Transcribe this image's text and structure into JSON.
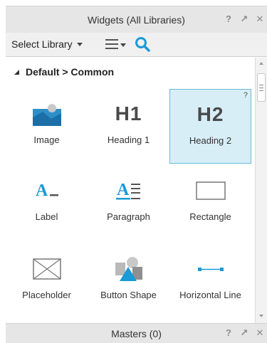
{
  "panel": {
    "title": "Widgets (All Libraries)",
    "help": "?",
    "popout": "↗",
    "close": "✕"
  },
  "toolbar": {
    "select_library": "Select Library"
  },
  "section": {
    "title": "Default > Common"
  },
  "widgets": [
    {
      "label": "Image",
      "icon": "image-icon"
    },
    {
      "label": "Heading 1",
      "glyph": "H1",
      "icon": "heading-1-icon"
    },
    {
      "label": "Heading 2",
      "glyph": "H2",
      "icon": "heading-2-icon",
      "selected": true,
      "help": "?"
    },
    {
      "label": "Label",
      "icon": "label-icon"
    },
    {
      "label": "Paragraph",
      "icon": "paragraph-icon"
    },
    {
      "label": "Rectangle",
      "icon": "rectangle-icon"
    },
    {
      "label": "Placeholder",
      "icon": "placeholder-icon"
    },
    {
      "label": "Button Shape",
      "icon": "button-shape-icon"
    },
    {
      "label": "Horizontal Line",
      "icon": "horizontal-line-icon"
    }
  ],
  "masters": {
    "title": "Masters (0)",
    "help": "?",
    "popout": "↗",
    "close": "✕"
  },
  "colors": {
    "accent": "#1a9ad6",
    "selected_bg": "#d7eef7",
    "selected_border": "#68b9d8"
  }
}
